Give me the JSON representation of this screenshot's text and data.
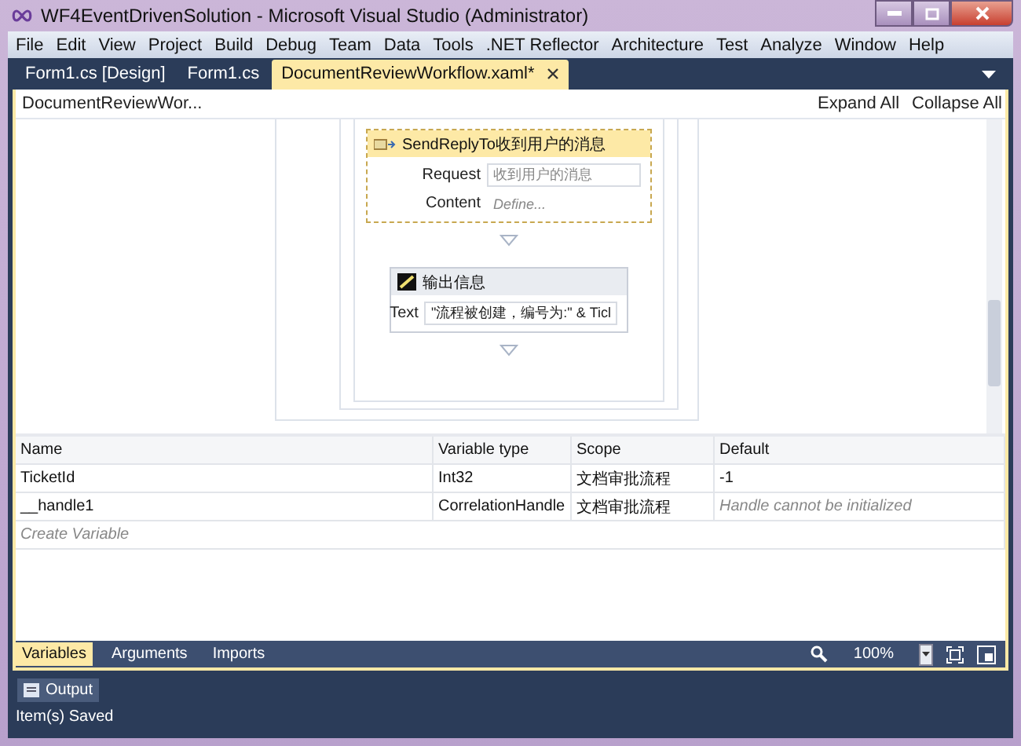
{
  "window": {
    "title": "WF4EventDrivenSolution - Microsoft Visual Studio (Administrator)"
  },
  "menu": [
    "File",
    "Edit",
    "View",
    "Project",
    "Build",
    "Debug",
    "Team",
    "Data",
    "Tools",
    ".NET Reflector",
    "Architecture",
    "Test",
    "Analyze",
    "Window",
    "Help"
  ],
  "tabs": [
    {
      "label": "Form1.cs [Design]",
      "selected": false
    },
    {
      "label": "Form1.cs",
      "selected": false
    },
    {
      "label": "DocumentReviewWorkflow.xaml*",
      "selected": true
    }
  ],
  "designer": {
    "breadcrumb": "DocumentReviewWor...",
    "actions": [
      "Expand All",
      "Collapse All"
    ],
    "activities": [
      {
        "kind": "send_reply",
        "title": "SendReplyTo收到用户的消息",
        "fields": [
          {
            "label": "Request",
            "value": "收到用户的消息"
          },
          {
            "label": "Content",
            "placeholder": "Define..."
          }
        ]
      },
      {
        "kind": "write_line",
        "title": "输出信息",
        "fields": [
          {
            "label": "Text",
            "value": "\"流程被创建，编号为:\" & Ticl"
          }
        ]
      }
    ]
  },
  "variables": {
    "columns": [
      "Name",
      "Variable type",
      "Scope",
      "Default"
    ],
    "rows": [
      {
        "name": "TicketId",
        "type": "Int32",
        "scope": "文档审批流程",
        "default": "-1"
      },
      {
        "name": "__handle1",
        "type": "CorrelationHandle",
        "scope": "文档审批流程",
        "default_placeholder": "Handle cannot be initialized"
      }
    ],
    "create_placeholder": "Create Variable"
  },
  "bottom_tabs": [
    {
      "label": "Variables",
      "selected": true
    },
    {
      "label": "Arguments",
      "selected": false
    },
    {
      "label": "Imports",
      "selected": false
    }
  ],
  "zoom": "100%",
  "output_button": "Output",
  "status_bar": "Item(s) Saved"
}
